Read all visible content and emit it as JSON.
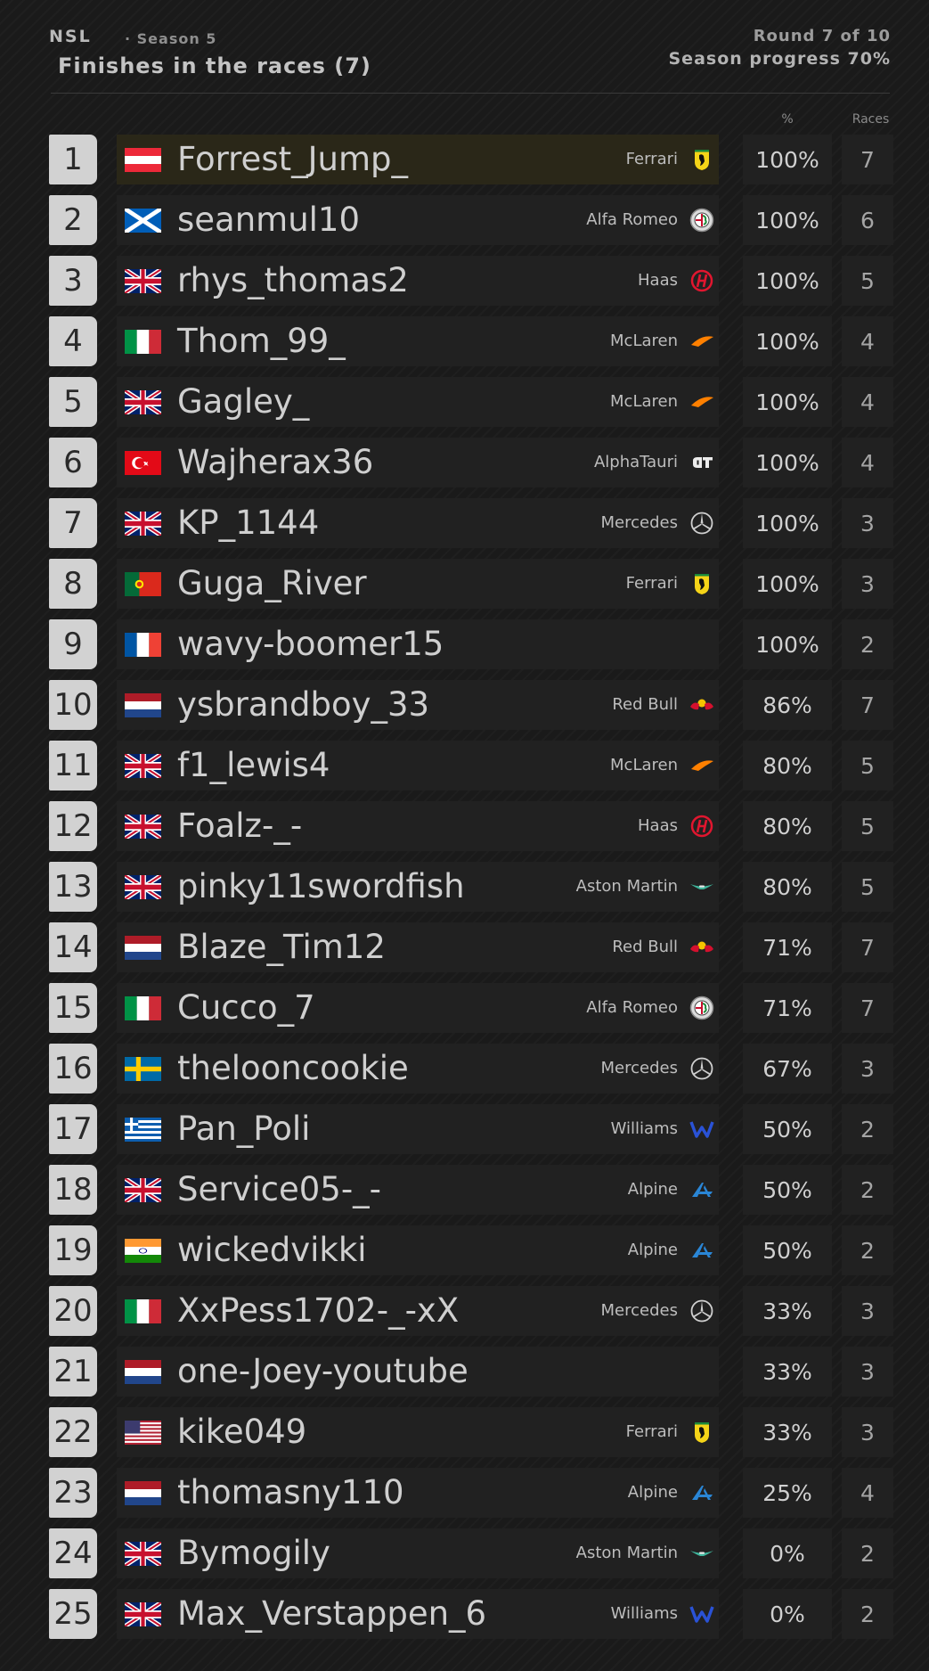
{
  "header": {
    "brand": "NSL",
    "season": "· Season 5",
    "title": "Finishes in the races (7)",
    "round": "Round 7 of 10",
    "progress": "Season progress 70%"
  },
  "columns": {
    "pct": "%",
    "races": "Races"
  },
  "rows": [
    {
      "pos": "1",
      "flag": "flag-austria",
      "name": "Forrest_Jump_",
      "team": "Ferrari",
      "team_icon": "ferrari-logo-icon",
      "pct": "100%",
      "races": "7"
    },
    {
      "pos": "2",
      "flag": "flag-scotland",
      "name": "seanmul10",
      "team": "Alfa Romeo",
      "team_icon": "alfa-romeo-logo-icon",
      "pct": "100%",
      "races": "6"
    },
    {
      "pos": "3",
      "flag": "flag-uk",
      "name": "rhys_thomas2",
      "team": "Haas",
      "team_icon": "haas-logo-icon",
      "pct": "100%",
      "races": "5"
    },
    {
      "pos": "4",
      "flag": "flag-italy",
      "name": "Thom_99_",
      "team": "McLaren",
      "team_icon": "mclaren-logo-icon",
      "pct": "100%",
      "races": "4"
    },
    {
      "pos": "5",
      "flag": "flag-uk",
      "name": "Gagley_",
      "team": "McLaren",
      "team_icon": "mclaren-logo-icon",
      "pct": "100%",
      "races": "4"
    },
    {
      "pos": "6",
      "flag": "flag-turkey",
      "name": "Wajherax36",
      "team": "AlphaTauri",
      "team_icon": "alphatauri-logo-icon",
      "pct": "100%",
      "races": "4"
    },
    {
      "pos": "7",
      "flag": "flag-uk",
      "name": "KP_1144",
      "team": "Mercedes",
      "team_icon": "mercedes-logo-icon",
      "pct": "100%",
      "races": "3"
    },
    {
      "pos": "8",
      "flag": "flag-portugal",
      "name": "Guga_River",
      "team": "Ferrari",
      "team_icon": "ferrari-logo-icon",
      "pct": "100%",
      "races": "3"
    },
    {
      "pos": "9",
      "flag": "flag-france",
      "name": "wavy-boomer15",
      "team": "",
      "team_icon": "",
      "pct": "100%",
      "races": "2"
    },
    {
      "pos": "10",
      "flag": "flag-netherlands",
      "name": "ysbrandboy_33",
      "team": "Red Bull",
      "team_icon": "red-bull-logo-icon",
      "pct": "86%",
      "races": "7"
    },
    {
      "pos": "11",
      "flag": "flag-uk",
      "name": "f1_lewis4",
      "team": "McLaren",
      "team_icon": "mclaren-logo-icon",
      "pct": "80%",
      "races": "5"
    },
    {
      "pos": "12",
      "flag": "flag-uk",
      "name": "Foalz-_-",
      "team": "Haas",
      "team_icon": "haas-logo-icon",
      "pct": "80%",
      "races": "5"
    },
    {
      "pos": "13",
      "flag": "flag-uk",
      "name": "pinky11swordfish",
      "team": "Aston Martin",
      "team_icon": "aston-martin-logo-icon",
      "pct": "80%",
      "races": "5"
    },
    {
      "pos": "14",
      "flag": "flag-netherlands",
      "name": "Blaze_Tim12",
      "team": "Red Bull",
      "team_icon": "red-bull-logo-icon",
      "pct": "71%",
      "races": "7"
    },
    {
      "pos": "15",
      "flag": "flag-italy",
      "name": "Cucco_7",
      "team": "Alfa Romeo",
      "team_icon": "alfa-romeo-logo-icon",
      "pct": "71%",
      "races": "7"
    },
    {
      "pos": "16",
      "flag": "flag-sweden",
      "name": "thelooncookie",
      "team": "Mercedes",
      "team_icon": "mercedes-logo-icon",
      "pct": "67%",
      "races": "3"
    },
    {
      "pos": "17",
      "flag": "flag-greece",
      "name": "Pan_Poli",
      "team": "Williams",
      "team_icon": "williams-logo-icon",
      "pct": "50%",
      "races": "2"
    },
    {
      "pos": "18",
      "flag": "flag-uk",
      "name": "Service05-_-",
      "team": "Alpine",
      "team_icon": "alpine-logo-icon",
      "pct": "50%",
      "races": "2"
    },
    {
      "pos": "19",
      "flag": "flag-india",
      "name": "wickedvikki",
      "team": "Alpine",
      "team_icon": "alpine-logo-icon",
      "pct": "50%",
      "races": "2"
    },
    {
      "pos": "20",
      "flag": "flag-italy",
      "name": "XxPess1702-_-xX",
      "team": "Mercedes",
      "team_icon": "mercedes-logo-icon",
      "pct": "33%",
      "races": "3"
    },
    {
      "pos": "21",
      "flag": "flag-netherlands",
      "name": "one-Joey-youtube",
      "team": "",
      "team_icon": "",
      "pct": "33%",
      "races": "3"
    },
    {
      "pos": "22",
      "flag": "flag-usa",
      "name": "kike049",
      "team": "Ferrari",
      "team_icon": "ferrari-logo-icon",
      "pct": "33%",
      "races": "3"
    },
    {
      "pos": "23",
      "flag": "flag-netherlands",
      "name": "thomasny110",
      "team": "Alpine",
      "team_icon": "alpine-logo-icon",
      "pct": "25%",
      "races": "4"
    },
    {
      "pos": "24",
      "flag": "flag-uk",
      "name": "Bymogily",
      "team": "Aston Martin",
      "team_icon": "aston-martin-logo-icon",
      "pct": "0%",
      "races": "2"
    },
    {
      "pos": "25",
      "flag": "flag-uk",
      "name": "Max_Verstappen_6",
      "team": "Williams",
      "team_icon": "williams-logo-icon",
      "pct": "0%",
      "races": "2"
    }
  ]
}
